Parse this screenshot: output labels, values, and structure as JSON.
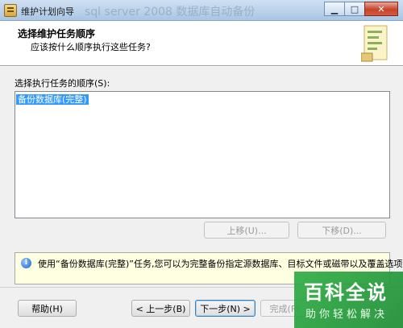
{
  "window": {
    "title": "维护计划向导",
    "background_ghost_text": "sql server 2008 数据库自动备份",
    "controls": [
      "minimize-icon",
      "maximize-icon",
      "close-icon"
    ],
    "minimize_glyph": "▁",
    "maximize_glyph": "□",
    "close_glyph": "✕"
  },
  "header": {
    "title": "选择维护任务顺序",
    "subtitle": "应该按什么顺序执行这些任务?"
  },
  "order": {
    "label": "选择执行任务的顺序(S):",
    "items": [
      {
        "label": "备份数据库(完整)",
        "selected": true
      }
    ],
    "move_up_label": "上移(U)...",
    "move_down_label": "下移(D)..."
  },
  "info": {
    "icon": "info-icon",
    "icon_glyph": "i",
    "text": "使用“备份数据库(完整)”任务,您可以为完整备份指定源数据库、目标文件或磁带以及覆盖选项。"
  },
  "footer": {
    "help_label": "帮助(H)",
    "back_label": "< 上一步(B)",
    "next_label": "下一步(N) >",
    "finish_label": "完成(F)"
  },
  "watermark": {
    "main": "百科全说",
    "sub": "助你轻松解决"
  },
  "colors": {
    "selection": "#3399ff",
    "info_background": "#ffffe1",
    "dialog_background": "#f0f0f0",
    "watermark": "#2fae45"
  }
}
